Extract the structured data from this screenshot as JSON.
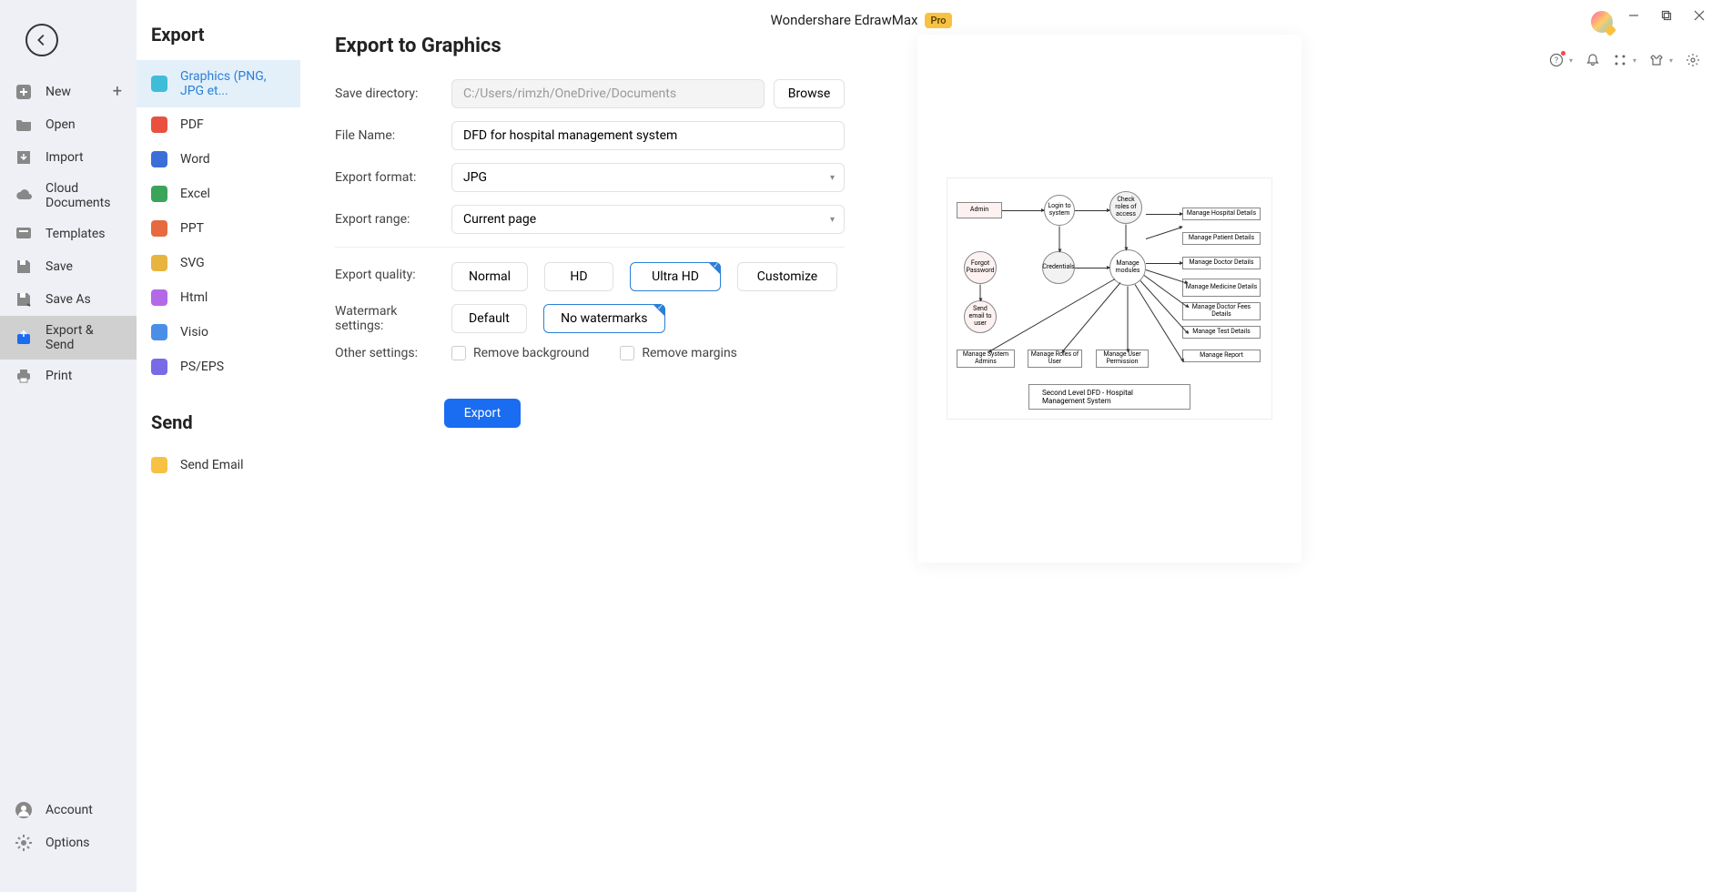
{
  "app": {
    "title": "Wondershare EdrawMax",
    "badge": "Pro"
  },
  "rail": {
    "new": "New",
    "open": "Open",
    "import": "Import",
    "cloud": "Cloud Documents",
    "templates": "Templates",
    "save": "Save",
    "saveas": "Save As",
    "export": "Export & Send",
    "print": "Print",
    "account": "Account",
    "options": "Options"
  },
  "sub": {
    "export_h": "Export",
    "send_h": "Send",
    "graphics": "Graphics (PNG, JPG et...",
    "pdf": "PDF",
    "word": "Word",
    "excel": "Excel",
    "ppt": "PPT",
    "svg": "SVG",
    "html": "Html",
    "visio": "Visio",
    "pseps": "PS/EPS",
    "email": "Send Email"
  },
  "form": {
    "heading": "Export to Graphics",
    "save_dir_label": "Save directory:",
    "save_dir_value": "C:/Users/rimzh/OneDrive/Documents",
    "browse": "Browse",
    "file_name_label": "File Name:",
    "file_name_value": "DFD for hospital management system",
    "format_label": "Export format:",
    "format_value": "JPG",
    "range_label": "Export range:",
    "range_value": "Current page",
    "quality_label": "Export quality:",
    "q_normal": "Normal",
    "q_hd": "HD",
    "q_uhd": "Ultra HD",
    "q_custom": "Customize",
    "watermark_label": "Watermark settings:",
    "w_default": "Default",
    "w_none": "No watermarks",
    "other_label": "Other settings:",
    "o_bg": "Remove background",
    "o_margin": "Remove margins",
    "export_btn": "Export"
  },
  "preview": {
    "caption": "Second Level DFD - Hospital Management System",
    "admin": "Admin",
    "login": "Login to system",
    "check": "Check roles of access",
    "forgot": "Forgot Password",
    "cred": "Credentials",
    "manage": "Manage modules",
    "sendmail": "Send email to user",
    "r1": "Manage Hospital Details",
    "r2": "Manage Patient Details",
    "r3": "Manage Doctor Details",
    "r4": "Manage Medicine Details",
    "r5": "Manage Doctor Fees Details",
    "r6": "Manage Test Details",
    "r7": "Manage Report",
    "b1": "Manage System Admins",
    "b2": "Manage Roles of User",
    "b3": "Manage User Permission"
  }
}
